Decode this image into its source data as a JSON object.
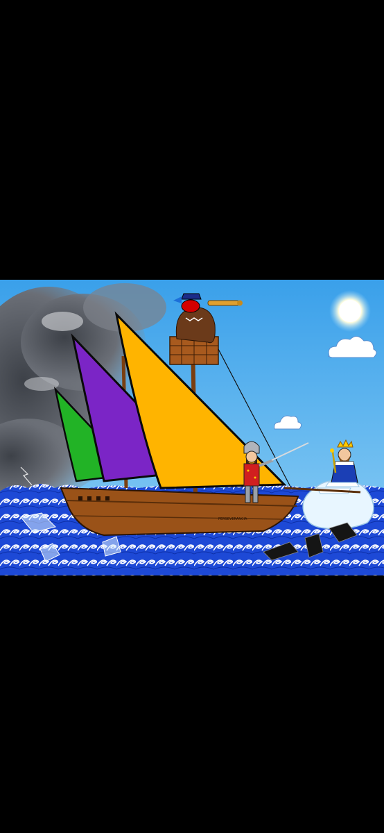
{
  "artwork": {
    "ship_name": "PERSEVERANCIA",
    "colors": {
      "sky": "#3fa0e6",
      "sea": "#1f4fd8",
      "sail_green": "#1fb01f",
      "sail_purple": "#7e22c9",
      "sail_yellow": "#ffb300",
      "hull": "#9a5218",
      "storm": "#5a5e66"
    }
  }
}
